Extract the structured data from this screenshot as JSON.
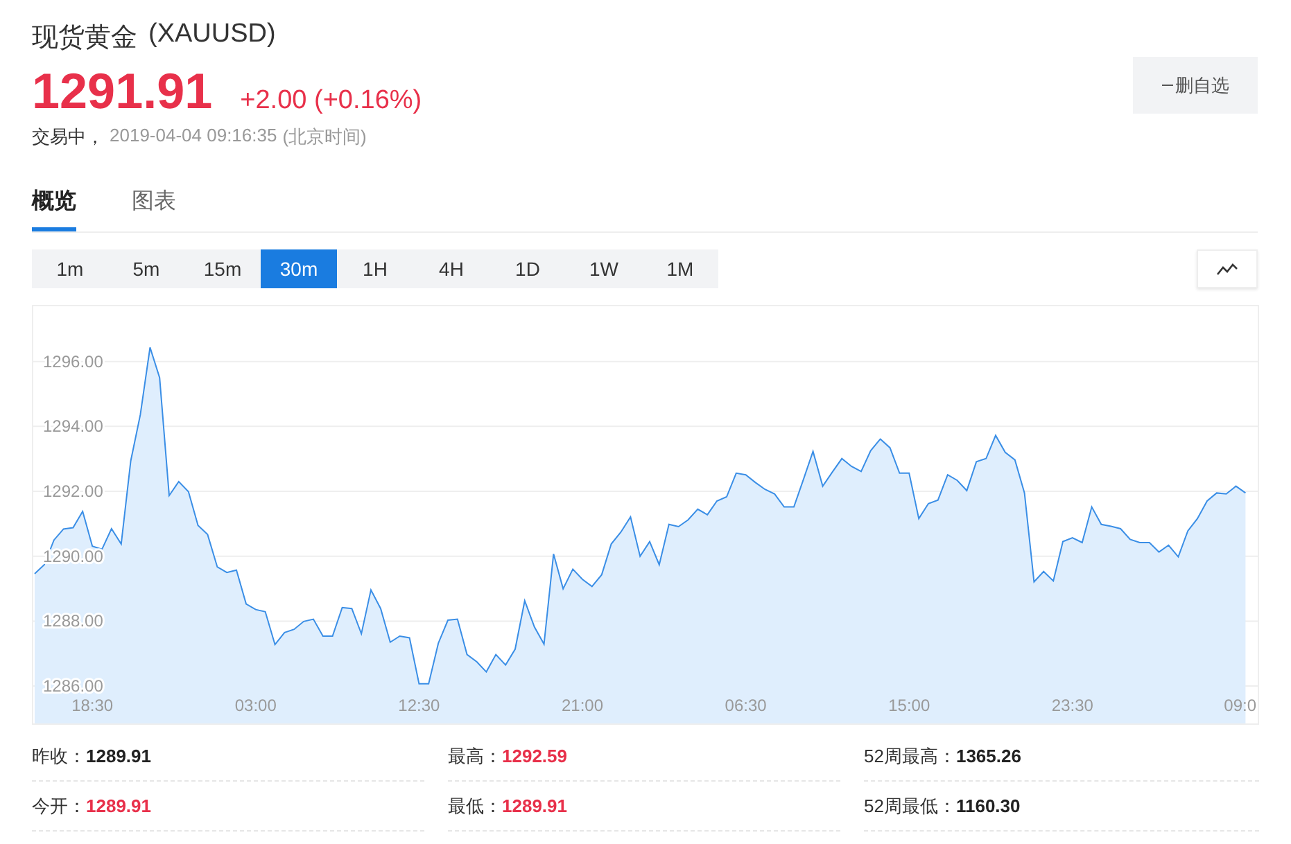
{
  "header": {
    "title": "现货黄金",
    "symbol": "(XAUUSD)",
    "price": "1291.91",
    "change": "+2.00 (+0.16%)",
    "status": "交易中，",
    "time": "2019-04-04 09:16:35",
    "timezone": "(北京时间)",
    "watch_button": "删自选"
  },
  "tabs": [
    {
      "label": "概览",
      "selected": true
    },
    {
      "label": "图表",
      "selected": false
    }
  ],
  "periods": [
    {
      "label": "1m",
      "selected": false
    },
    {
      "label": "5m",
      "selected": false
    },
    {
      "label": "15m",
      "selected": false
    },
    {
      "label": "30m",
      "selected": true
    },
    {
      "label": "1H",
      "selected": false
    },
    {
      "label": "4H",
      "selected": false
    },
    {
      "label": "1D",
      "selected": false
    },
    {
      "label": "1W",
      "selected": false
    },
    {
      "label": "1M",
      "selected": false
    }
  ],
  "chart": {
    "chart_data": {
      "type": "area",
      "grid": true,
      "ylim": [
        1284.85,
        1297.7
      ],
      "yticks": [
        {
          "value": 1286,
          "label": "1286.00"
        },
        {
          "value": 1288,
          "label": "1288.00"
        },
        {
          "value": 1290,
          "label": "1290.00"
        },
        {
          "value": 1292,
          "label": "1292.00"
        },
        {
          "value": 1294,
          "label": "1294.00"
        },
        {
          "value": 1296,
          "label": "1296.00"
        }
      ],
      "categories": [
        null,
        null,
        null,
        null,
        null,
        null,
        "18:30",
        null,
        null,
        null,
        null,
        null,
        null,
        null,
        null,
        null,
        null,
        null,
        null,
        null,
        null,
        null,
        null,
        "03:00",
        null,
        null,
        null,
        null,
        null,
        null,
        null,
        null,
        null,
        null,
        null,
        null,
        null,
        null,
        null,
        null,
        "12:30",
        null,
        null,
        null,
        null,
        null,
        null,
        null,
        null,
        null,
        null,
        null,
        null,
        null,
        null,
        null,
        null,
        "21:00",
        null,
        null,
        null,
        null,
        null,
        null,
        null,
        null,
        null,
        null,
        null,
        null,
        null,
        null,
        null,
        null,
        "06:30",
        null,
        null,
        null,
        null,
        null,
        null,
        null,
        null,
        null,
        null,
        null,
        null,
        null,
        null,
        null,
        null,
        "15:00",
        null,
        null,
        null,
        null,
        null,
        null,
        null,
        null,
        null,
        null,
        null,
        null,
        null,
        null,
        null,
        null,
        "23:30",
        null,
        null,
        null,
        null,
        null,
        null,
        null,
        null,
        null,
        null,
        null,
        null,
        null,
        null,
        null,
        null,
        "09:0",
        null
      ],
      "series": [
        {
          "color": "#3a8ee6",
          "values": [
            1289.46,
            1289.74,
            1290.5,
            1290.84,
            1290.88,
            1291.38,
            1290.31,
            1290.21,
            1290.85,
            1290.38,
            1292.94,
            1294.36,
            1296.43,
            1295.5,
            1291.87,
            1292.3,
            1291.99,
            1290.95,
            1290.67,
            1289.67,
            1289.5,
            1289.57,
            1288.53,
            1288.36,
            1288.29,
            1287.28,
            1287.65,
            1287.75,
            1287.99,
            1288.06,
            1287.54,
            1287.54,
            1288.42,
            1288.39,
            1287.61,
            1288.96,
            1288.39,
            1287.35,
            1287.54,
            1287.49,
            1286.07,
            1286.07,
            1287.32,
            1288.03,
            1288.06,
            1286.97,
            1286.75,
            1286.44,
            1286.97,
            1286.65,
            1287.14,
            1288.63,
            1287.82,
            1287.29,
            1290.07,
            1289.0,
            1289.6,
            1289.29,
            1289.07,
            1289.43,
            1290.38,
            1290.74,
            1291.21,
            1290.0,
            1290.45,
            1289.74,
            1290.98,
            1290.91,
            1291.12,
            1291.45,
            1291.28,
            1291.7,
            1291.83,
            1292.56,
            1292.51,
            1292.27,
            1292.06,
            1291.92,
            1291.52,
            1291.52,
            1292.37,
            1293.23,
            1292.16,
            1292.59,
            1293.01,
            1292.77,
            1292.61,
            1293.25,
            1293.61,
            1293.34,
            1292.56,
            1292.56,
            1291.16,
            1291.62,
            1291.73,
            1292.51,
            1292.34,
            1292.02,
            1292.91,
            1293.01,
            1293.72,
            1293.2,
            1292.97,
            1291.95,
            1289.21,
            1289.53,
            1289.24,
            1290.45,
            1290.57,
            1290.42,
            1291.52,
            1290.98,
            1290.92,
            1290.85,
            1290.52,
            1290.42,
            1290.42,
            1290.13,
            1290.34,
            1289.98,
            1290.78,
            1291.16,
            1291.7,
            1291.95,
            1291.92,
            1292.16,
            1291.95
          ]
        }
      ]
    }
  },
  "stats": [
    {
      "label": "昨收：",
      "value": "1289.91",
      "color": "#222222"
    },
    {
      "label": "最高：",
      "value": "1292.59",
      "color": "#e8304a"
    },
    {
      "label": "52周最高：",
      "value": "1365.26",
      "color": "#222222"
    },
    {
      "label": "今开：",
      "value": "1289.91",
      "color": "#e8304a"
    },
    {
      "label": "最低：",
      "value": "1289.91",
      "color": "#e8304a"
    },
    {
      "label": "52周最低：",
      "value": "1160.30",
      "color": "#222222"
    }
  ]
}
